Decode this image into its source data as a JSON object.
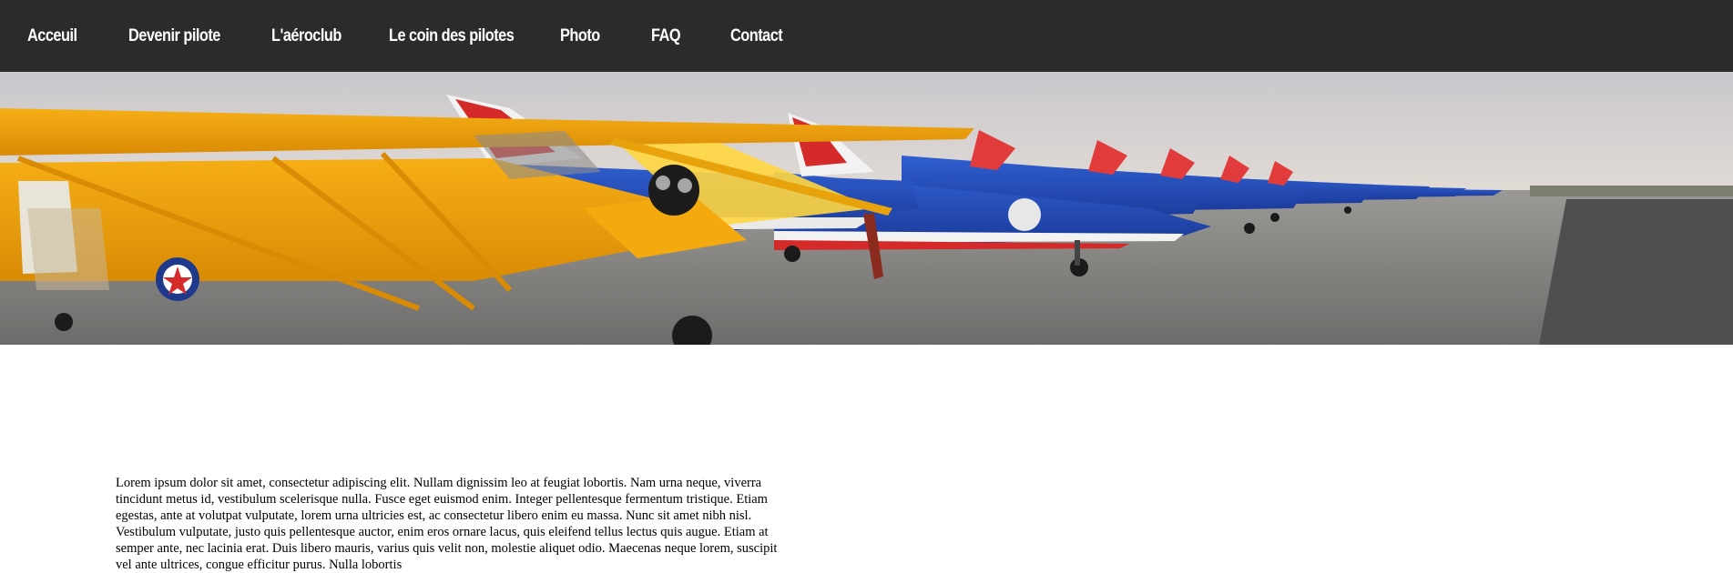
{
  "nav": {
    "items": [
      {
        "label": "Acceuil"
      },
      {
        "label": "Devenir pilote"
      },
      {
        "label": "L'aéroclub"
      },
      {
        "label": "Le coin des pilotes"
      },
      {
        "label": "Photo"
      },
      {
        "label": "FAQ"
      },
      {
        "label": "Contact"
      }
    ]
  },
  "colors": {
    "navbar_bg": "#2b2b2b",
    "nav_text": "#ffffff",
    "body_bg": "#ffffff"
  },
  "hero": {
    "image_description_icon": "airplanes-banner-image"
  },
  "main": {
    "paragraph": "Lorem ipsum dolor sit amet, consectetur adipiscing elit. Nullam dignissim leo at feugiat lobortis. Nam urna neque, viverra tincidunt metus id, vestibulum scelerisque nulla. Fusce eget euismod enim. Integer pellentesque fermentum tristique. Etiam egestas, ante at volutpat vulputate, lorem urna ultricies est, ac consectetur libero enim eu massa. Nunc sit amet nibh nisl. Vestibulum vulputate, justo quis pellentesque auctor, enim eros ornare lacus, quis eleifend tellus lectus quis augue. Etiam at semper ante, nec lacinia erat. Duis libero mauris, varius quis velit non, molestie aliquet odio. Maecenas neque lorem, suscipit vel ante ultrices, congue efficitur purus. Nulla lobortis"
  }
}
